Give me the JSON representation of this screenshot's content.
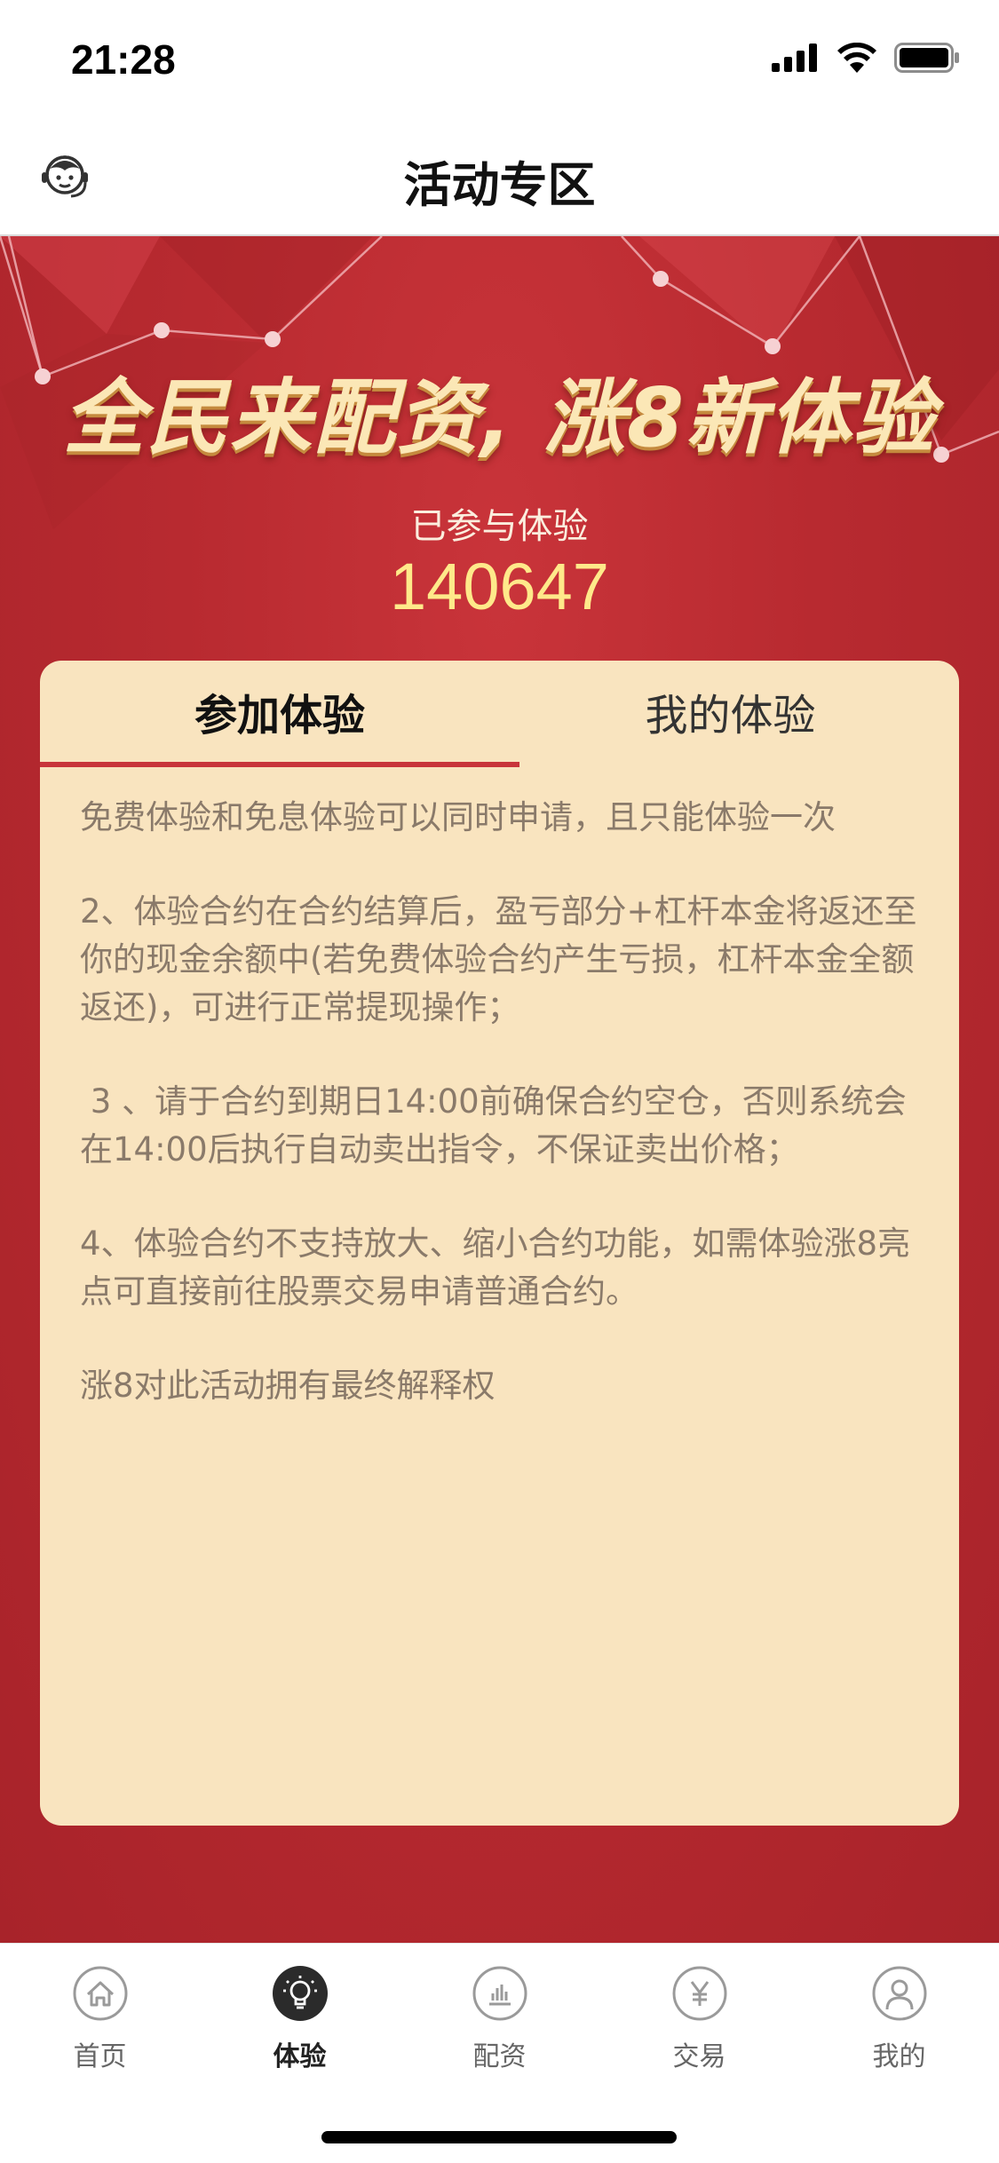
{
  "status": {
    "time": "21:28"
  },
  "nav": {
    "title": "活动专区",
    "support_icon": "customer-service-icon"
  },
  "promo": {
    "headline": "全民来配资, 涨8新体验",
    "participated_label": "已参与体验",
    "participated_count": "140647"
  },
  "tabs": {
    "join_label": "参加体验",
    "mine_label": "我的体验",
    "active": "join"
  },
  "rules": [
    "免费体验和免息体验可以同时申请，且只能体验一次",
    "2、体验合约在合约结算后，盈亏部分+杠杆本金将返还至你的现金余额中(若免费体验合约产生亏损，杠杆本金全额返还)，可进行正常提现操作；",
    " 3 、请于合约到期日14:00前确保合约空仓，否则系统会在14:00后执行自动卖出指令，不保证卖出价格；",
    "4、体验合约不支持放大、缩小合约功能，如需体验涨8亮点可直接前往股票交易申请普通合约。",
    "涨8对此活动拥有最终解释权"
  ],
  "tab_bar": {
    "items": [
      {
        "label": "首页",
        "icon": "home-icon",
        "active": false
      },
      {
        "label": "体验",
        "icon": "lightbulb-icon",
        "active": true
      },
      {
        "label": "配资",
        "icon": "chart-icon",
        "active": false
      },
      {
        "label": "交易",
        "icon": "yen-icon",
        "active": false
      },
      {
        "label": "我的",
        "icon": "user-icon",
        "active": false
      }
    ]
  },
  "colors": {
    "brand_red": "#c8353a",
    "card_bg": "#f9e4bf",
    "count_yellow": "#ffe98a"
  }
}
